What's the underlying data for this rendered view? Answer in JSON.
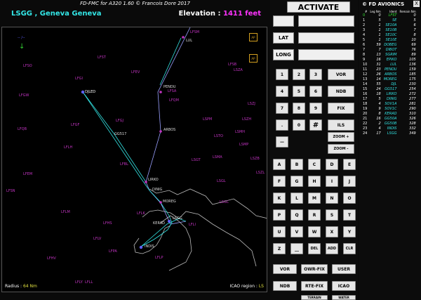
{
  "title": "FD-FMC for A320 1.60 © Francois Dore 2017",
  "info": {
    "airport": "LSGG , Geneva  Geneva",
    "elevation_label": "Elevation : ",
    "elevation_value": "1411 feet"
  },
  "map": {
    "radius_label": "Radius : ",
    "radius_value": "64 Nm",
    "icao_label": "ICAO region : ",
    "icao_value": "LS",
    "scale_label": "-- /--"
  },
  "panel": {
    "activate": "ACTIVATE",
    "lat": "LAT",
    "long": "LONG",
    "keypad": [
      "1",
      "2",
      "3",
      "4",
      "5",
      "6",
      "7",
      "8",
      "9",
      ".",
      "0",
      "#",
      "—"
    ],
    "nav": [
      "VOR",
      "NDB",
      "FIX",
      "ILS",
      "ZOOM +",
      "ZOOM -"
    ],
    "letters": [
      "A",
      "B",
      "C",
      "D",
      "E",
      "F",
      "G",
      "H",
      "I",
      "J",
      "K",
      "L",
      "M",
      "N",
      "O",
      "P",
      "Q",
      "R",
      "S",
      "T",
      "U",
      "V",
      "W",
      "X",
      "Y",
      "Z",
      "__",
      "DEL",
      "ADD",
      "CLR"
    ],
    "bottom1": [
      "VOR",
      "OWR-FIX",
      "USER"
    ],
    "bottom2": [
      "NDB",
      "RTE-FIX",
      "ICAO"
    ],
    "bottom3": [
      "TERRAIN",
      "WATER"
    ]
  },
  "fplan": {
    "header": "© FD AVIONICS",
    "close": "X",
    "columns": [
      "#",
      "Leg Nm",
      "Ident",
      "Remain Nm"
    ],
    "rows": [
      [
        "0",
        "0",
        "LFST",
        "0"
      ],
      [
        "1",
        "5",
        "SE",
        "5"
      ],
      [
        "2",
        "1",
        "SE10A",
        "6"
      ],
      [
        "3",
        "1",
        "SE10B",
        "7"
      ],
      [
        "4",
        "1",
        "SE10C",
        "8"
      ],
      [
        "5",
        "1",
        "SE10E",
        "10"
      ],
      [
        "6",
        "59",
        "DOBEG",
        "69"
      ],
      [
        "7",
        "7",
        "DIBOT",
        "76"
      ],
      [
        "8",
        "13",
        "SGRIM",
        "89"
      ],
      [
        "9",
        "16",
        "EPIKO",
        "105"
      ],
      [
        "10",
        "31",
        "LUL",
        "136"
      ],
      [
        "11",
        "23",
        "PENDU",
        "159"
      ],
      [
        "12",
        "26",
        "ARBOS",
        "185"
      ],
      [
        "13",
        "14",
        "MOREG",
        "175"
      ],
      [
        "14",
        "55",
        "DJL",
        "230"
      ],
      [
        "15",
        "24",
        "GG517",
        "254"
      ],
      [
        "16",
        "18",
        "LIRKO",
        "272"
      ],
      [
        "17",
        "5",
        "DINIG",
        "277"
      ],
      [
        "18",
        "4",
        "SOV1A",
        "281"
      ],
      [
        "19",
        "9",
        "SOV1C",
        "290"
      ],
      [
        "20",
        "8",
        "KERAD",
        "310"
      ],
      [
        "21",
        "16",
        "GG50A",
        "326"
      ],
      [
        "22",
        "2",
        "GG50B",
        "328"
      ],
      [
        "23",
        "4",
        "INDIS",
        "332"
      ],
      [
        "24",
        "17",
        "LSGG",
        "349"
      ]
    ]
  },
  "waypoints": [
    {
      "name": "LFSO"
    },
    {
      "name": "LFST"
    },
    {
      "name": "LFGI"
    },
    {
      "name": "LFEV"
    },
    {
      "name": "LFSA"
    },
    {
      "name": "LFQM"
    },
    {
      "name": "LFGW"
    },
    {
      "name": "DJLED"
    },
    {
      "name": "LFGF"
    },
    {
      "name": "LFQB"
    },
    {
      "name": "LFGJ"
    },
    {
      "name": "LFLH"
    },
    {
      "name": "LFBL"
    },
    {
      "name": "LFEM"
    },
    {
      "name": "LFSN"
    },
    {
      "name": "LFLM"
    },
    {
      "name": "LFHS"
    },
    {
      "name": "LFLV"
    },
    {
      "name": "LFPA"
    },
    {
      "name": "LFLP"
    },
    {
      "name": "LFLY"
    },
    {
      "name": "LFLL"
    },
    {
      "name": "LFHV"
    },
    {
      "name": "LFLI"
    },
    {
      "name": "LFLK"
    },
    {
      "name": "LSGL"
    },
    {
      "name": "LSGC"
    },
    {
      "name": "LSZA"
    },
    {
      "name": "LSZJ"
    },
    {
      "name": "LSZH"
    },
    {
      "name": "LSMP"
    },
    {
      "name": "LSPM"
    },
    {
      "name": "LSTO"
    },
    {
      "name": "LSMH"
    },
    {
      "name": "LSMA"
    },
    {
      "name": "LSZB"
    },
    {
      "name": "LSGT"
    },
    {
      "name": "LSZL"
    },
    {
      "name": "LFSM"
    },
    {
      "name": "LFSB"
    }
  ],
  "route_labels": [
    "LUL",
    "PENDU",
    "ARBOS",
    "GG517",
    "LIRKO",
    "DINIG",
    "MOREG",
    "KERAD",
    "LSGG",
    "INDIS"
  ]
}
